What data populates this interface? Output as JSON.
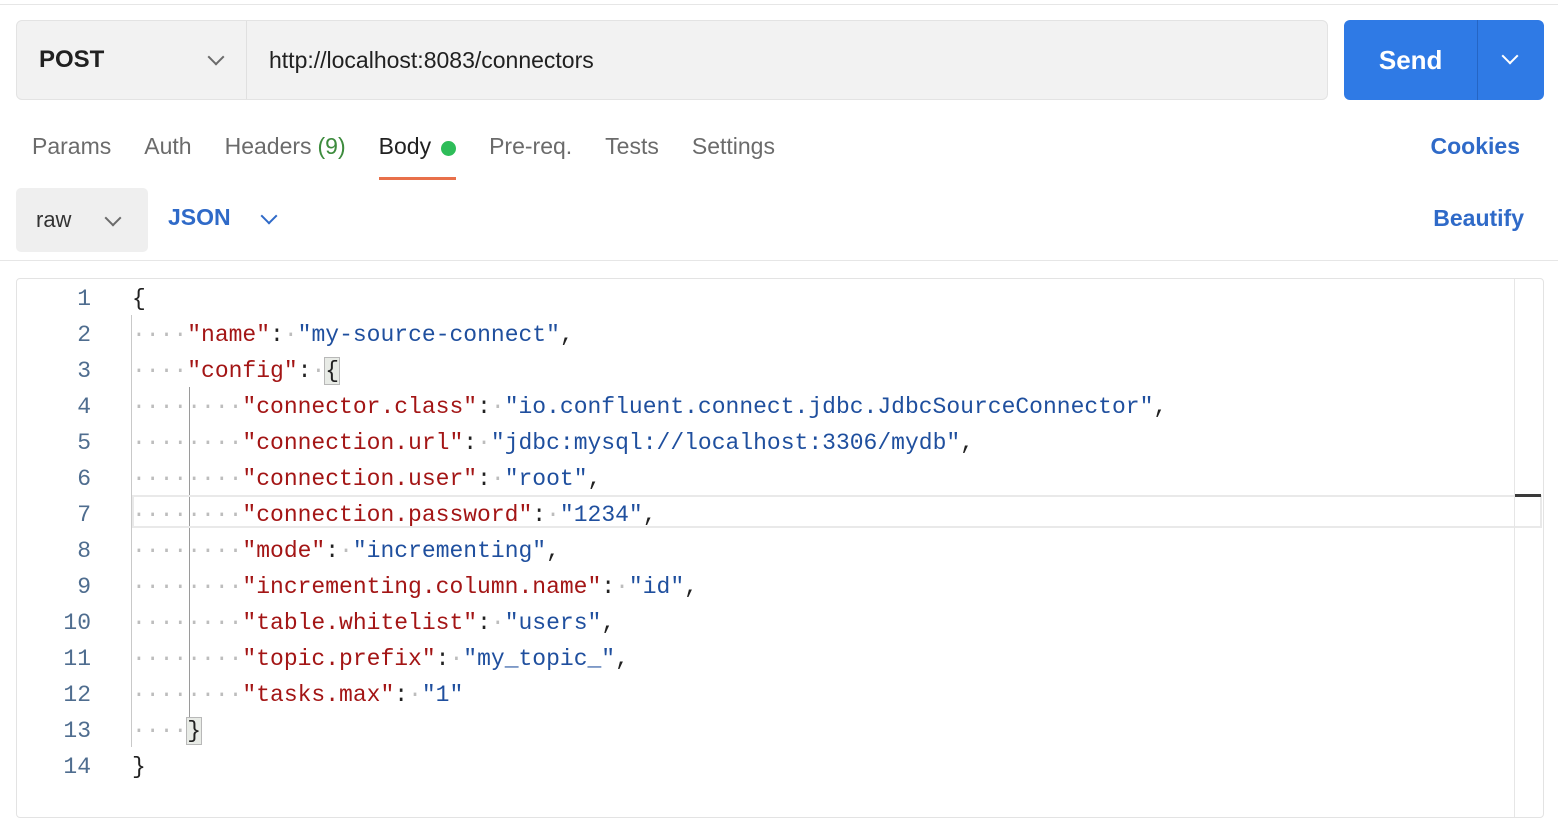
{
  "request": {
    "method": "POST",
    "url": "http://localhost:8083/connectors",
    "send_label": "Send"
  },
  "tabs": [
    {
      "label": "Params"
    },
    {
      "label": "Auth"
    },
    {
      "label": "Headers",
      "count": "(9)"
    },
    {
      "label": "Body",
      "active": true,
      "indicator": "green-dot"
    },
    {
      "label": "Pre-req."
    },
    {
      "label": "Tests"
    },
    {
      "label": "Settings"
    }
  ],
  "cookies_label": "Cookies",
  "body_toolbar": {
    "mode": "raw",
    "language": "JSON",
    "beautify_label": "Beautify"
  },
  "editor": {
    "lines": [
      {
        "n": "1",
        "indent": 0,
        "parts": [
          [
            "p",
            "{"
          ]
        ]
      },
      {
        "n": "2",
        "indent": 1,
        "parts": [
          [
            "k",
            "\"name\""
          ],
          [
            "p",
            ":"
          ],
          [
            "ws",
            "·"
          ],
          [
            "s",
            "\"my-source-connect\""
          ],
          [
            "p",
            ","
          ]
        ]
      },
      {
        "n": "3",
        "indent": 1,
        "parts": [
          [
            "k",
            "\"config\""
          ],
          [
            "p",
            ":"
          ],
          [
            "ws",
            "·"
          ],
          [
            "b",
            "{"
          ]
        ]
      },
      {
        "n": "4",
        "indent": 2,
        "parts": [
          [
            "k",
            "\"connector.class\""
          ],
          [
            "p",
            ":"
          ],
          [
            "ws",
            "·"
          ],
          [
            "s",
            "\"io.confluent.connect.jdbc.JdbcSourceConnector\""
          ],
          [
            "p",
            ","
          ]
        ]
      },
      {
        "n": "5",
        "indent": 2,
        "parts": [
          [
            "k",
            "\"connection.url\""
          ],
          [
            "p",
            ":"
          ],
          [
            "ws",
            "·"
          ],
          [
            "s",
            "\"jdbc:mysql://localhost:3306/mydb\""
          ],
          [
            "p",
            ","
          ]
        ]
      },
      {
        "n": "6",
        "indent": 2,
        "parts": [
          [
            "k",
            "\"connection.user\""
          ],
          [
            "p",
            ":"
          ],
          [
            "ws",
            "·"
          ],
          [
            "s",
            "\"root\""
          ],
          [
            "p",
            ","
          ]
        ]
      },
      {
        "n": "7",
        "indent": 2,
        "parts": [
          [
            "k",
            "\"connection.password\""
          ],
          [
            "p",
            ":"
          ],
          [
            "ws",
            "·"
          ],
          [
            "s",
            "\"1234\""
          ],
          [
            "p",
            ","
          ]
        ]
      },
      {
        "n": "8",
        "indent": 2,
        "parts": [
          [
            "k",
            "\"mode\""
          ],
          [
            "p",
            ":"
          ],
          [
            "ws",
            "·"
          ],
          [
            "s",
            "\"incrementing\""
          ],
          [
            "p",
            ","
          ]
        ]
      },
      {
        "n": "9",
        "indent": 2,
        "parts": [
          [
            "k",
            "\"incrementing.column.name\""
          ],
          [
            "p",
            ":"
          ],
          [
            "ws",
            "·"
          ],
          [
            "s",
            "\"id\""
          ],
          [
            "p",
            ","
          ]
        ]
      },
      {
        "n": "10",
        "indent": 2,
        "parts": [
          [
            "k",
            "\"table.whitelist\""
          ],
          [
            "p",
            ":"
          ],
          [
            "ws",
            "·"
          ],
          [
            "s",
            "\"users\""
          ],
          [
            "p",
            ","
          ]
        ]
      },
      {
        "n": "11",
        "indent": 2,
        "parts": [
          [
            "k",
            "\"topic.prefix\""
          ],
          [
            "p",
            ":"
          ],
          [
            "ws",
            "·"
          ],
          [
            "s",
            "\"my_topic_\""
          ],
          [
            "p",
            ","
          ]
        ]
      },
      {
        "n": "12",
        "indent": 2,
        "parts": [
          [
            "k",
            "\"tasks.max\""
          ],
          [
            "p",
            ":"
          ],
          [
            "ws",
            "·"
          ],
          [
            "s",
            "\"1\""
          ]
        ]
      },
      {
        "n": "13",
        "indent": 1,
        "parts": [
          [
            "b",
            "}"
          ]
        ]
      },
      {
        "n": "14",
        "indent": 0,
        "parts": [
          [
            "p",
            "}"
          ]
        ]
      }
    ],
    "current_line": "7"
  },
  "colors": {
    "send_button": "#2f7ae5",
    "link_blue": "#2f6ac8",
    "active_tab_underline": "#e8704a",
    "body_dot": "#2ebd59",
    "json_key": "#a31515",
    "json_string": "#1f4f9e"
  }
}
